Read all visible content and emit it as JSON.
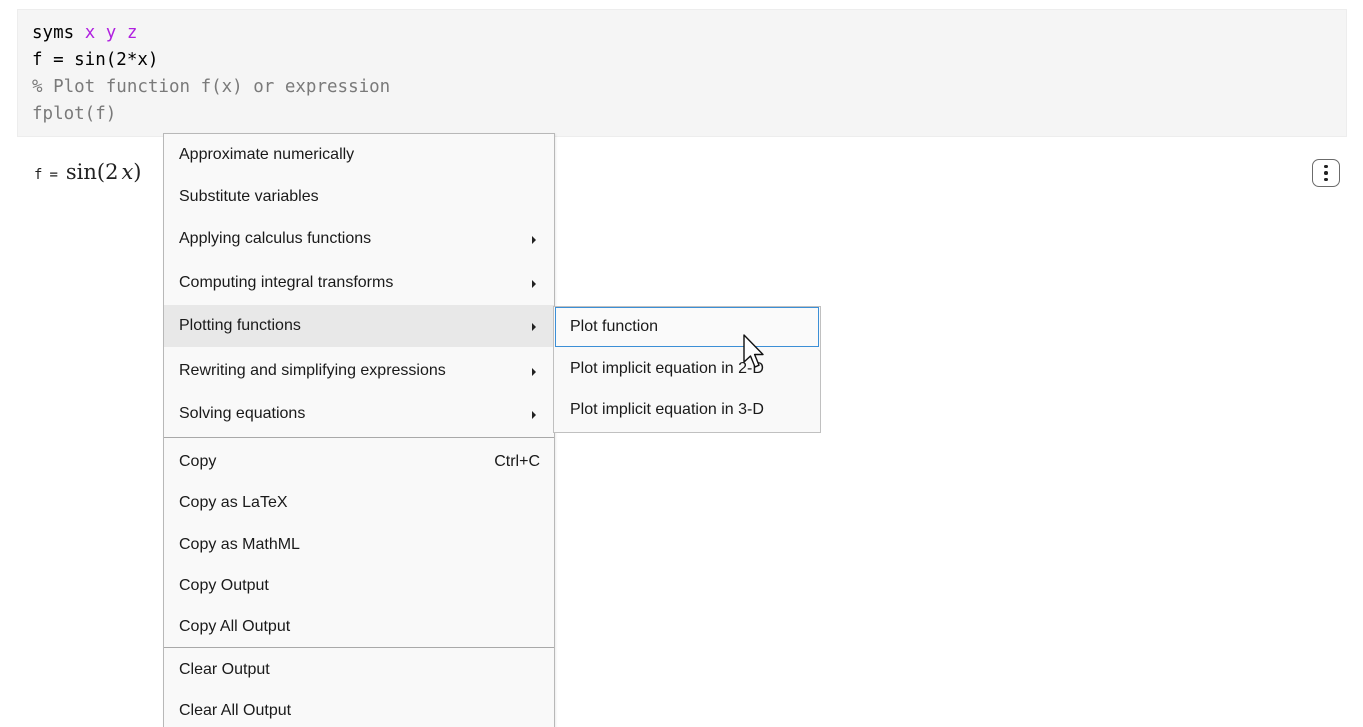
{
  "code": {
    "line1": {
      "keyword": "syms",
      "vars": "x y z"
    },
    "line2": "f = sin(2*x)",
    "line3": "% Plot function f(x) or expression",
    "line4": "fplot(f)"
  },
  "output": {
    "variable": "f",
    "equals": "=",
    "expression_fn": "sin(2",
    "expression_var": "x",
    "expression_close": ")"
  },
  "context_menu": {
    "items": [
      {
        "label": "Approximate numerically",
        "has_submenu": false
      },
      {
        "label": "Substitute variables",
        "has_submenu": false
      },
      {
        "label": "Applying calculus functions",
        "has_submenu": true
      },
      {
        "label": "Computing integral transforms",
        "has_submenu": true
      },
      {
        "label": "Plotting functions",
        "has_submenu": true,
        "highlighted": true
      },
      {
        "label": "Rewriting and simplifying expressions",
        "has_submenu": true
      },
      {
        "label": "Solving equations",
        "has_submenu": true
      },
      {
        "label": "Copy",
        "shortcut": "Ctrl+C"
      },
      {
        "label": "Copy as LaTeX"
      },
      {
        "label": "Copy as MathML"
      },
      {
        "label": "Copy Output"
      },
      {
        "label": "Copy All Output"
      },
      {
        "label": "Clear Output"
      },
      {
        "label": "Clear All Output"
      }
    ]
  },
  "submenu": {
    "items": [
      {
        "label": "Plot function",
        "active": true
      },
      {
        "label": "Plot implicit equation in 2-D"
      },
      {
        "label": "Plot implicit equation in 3-D"
      }
    ]
  },
  "colors": {
    "accent": "#3c8fd6",
    "keyword_var": "#b020e0",
    "comment": "#7a7a7a"
  }
}
